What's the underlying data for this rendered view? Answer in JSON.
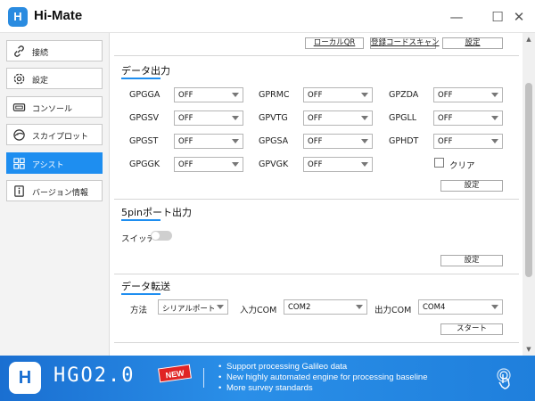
{
  "window": {
    "logo_text": "H",
    "title": "Hi-Mate",
    "minimize": "—",
    "maximize": "☐",
    "close": "✕"
  },
  "sidebar": {
    "items": [
      {
        "label": "接続",
        "icon": "link-icon"
      },
      {
        "label": "設定",
        "icon": "gear-icon"
      },
      {
        "label": "コンソール",
        "icon": "console-icon"
      },
      {
        "label": "スカイプロット",
        "icon": "skyplot-icon"
      },
      {
        "label": "アシスト",
        "icon": "grid-icon",
        "active": true
      },
      {
        "label": "バージョン情報",
        "icon": "info-icon"
      }
    ]
  },
  "top_buttons": {
    "local_qr": "ローカルQR",
    "register_code_scan": "登録コードスキャン",
    "settings": "設定"
  },
  "data_output": {
    "title": "データ出力",
    "fields": [
      {
        "label": "GPGGA",
        "value": "OFF"
      },
      {
        "label": "GPRMC",
        "value": "OFF"
      },
      {
        "label": "GPZDA",
        "value": "OFF"
      },
      {
        "label": "GPGSV",
        "value": "OFF"
      },
      {
        "label": "GPVTG",
        "value": "OFF"
      },
      {
        "label": "GPGLL",
        "value": "OFF"
      },
      {
        "label": "GPGST",
        "value": "OFF"
      },
      {
        "label": "GPGSA",
        "value": "OFF"
      },
      {
        "label": "GPHDT",
        "value": "OFF"
      },
      {
        "label": "GPGGK",
        "value": "OFF"
      },
      {
        "label": "GPVGK",
        "value": "OFF"
      }
    ],
    "clear_label": "クリア",
    "settings_button": "設定"
  },
  "pin5_output": {
    "title": "5pinポート出力",
    "switch_label": "スイッチ",
    "switch_on": false,
    "settings_button": "設定"
  },
  "data_transfer": {
    "title": "データ転送",
    "method_label": "方法",
    "method_value": "シリアルポート",
    "input_com_label": "入力COM",
    "input_com_value": "COM2",
    "output_com_label": "出力COM",
    "output_com_value": "COM4",
    "start_button": "スタート"
  },
  "banner": {
    "logo_text": "H",
    "product": "HGO2.0",
    "badge": "NEW",
    "bullets": [
      "Support processing Galileo data",
      "New highly automated engine for processing baseline",
      "More survey standards"
    ]
  },
  "colors": {
    "accent": "#1e8ef0",
    "banner": "#2a8fe8"
  }
}
